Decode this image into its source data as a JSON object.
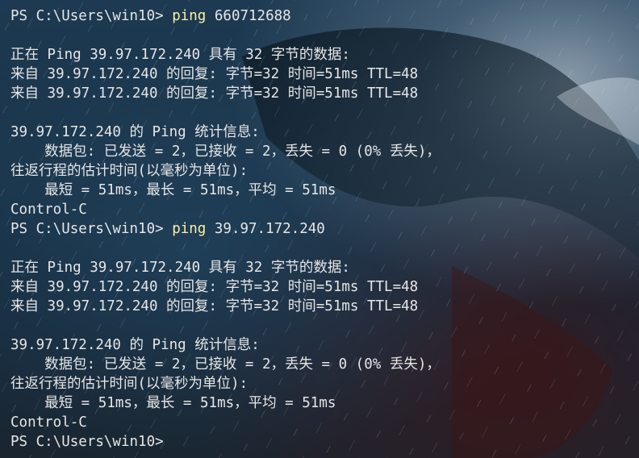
{
  "theme": {
    "text_color": "#e6e6e6",
    "command_color": "#f9f1a5",
    "background_color": "#193247"
  },
  "terminal": {
    "lines": [
      {
        "prompt": "PS C:\\Users\\win10> ",
        "command": "ping",
        "args": " 660712688"
      },
      {
        "text": ""
      },
      {
        "text": "正在 Ping 39.97.172.240 具有 32 字节的数据:"
      },
      {
        "text": "来自 39.97.172.240 的回复: 字节=32 时间=51ms TTL=48"
      },
      {
        "text": "来自 39.97.172.240 的回复: 字节=32 时间=51ms TTL=48"
      },
      {
        "text": ""
      },
      {
        "text": "39.97.172.240 的 Ping 统计信息:"
      },
      {
        "text": "    数据包: 已发送 = 2，已接收 = 2，丢失 = 0 (0% 丢失)，"
      },
      {
        "text": "往返行程的估计时间(以毫秒为单位):"
      },
      {
        "text": "    最短 = 51ms，最长 = 51ms，平均 = 51ms"
      },
      {
        "text": "Control-C"
      },
      {
        "prompt": "PS C:\\Users\\win10> ",
        "command": "ping",
        "args": " 39.97.172.240"
      },
      {
        "text": ""
      },
      {
        "text": "正在 Ping 39.97.172.240 具有 32 字节的数据:"
      },
      {
        "text": "来自 39.97.172.240 的回复: 字节=32 时间=51ms TTL=48"
      },
      {
        "text": "来自 39.97.172.240 的回复: 字节=32 时间=51ms TTL=48"
      },
      {
        "text": ""
      },
      {
        "text": "39.97.172.240 的 Ping 统计信息:"
      },
      {
        "text": "    数据包: 已发送 = 2，已接收 = 2，丢失 = 0 (0% 丢失)，"
      },
      {
        "text": "往返行程的估计时间(以毫秒为单位):"
      },
      {
        "text": "    最短 = 51ms，最长 = 51ms，平均 = 51ms"
      },
      {
        "text": "Control-C"
      },
      {
        "prompt": "PS C:\\Users\\win10>",
        "command": "",
        "args": ""
      }
    ]
  }
}
